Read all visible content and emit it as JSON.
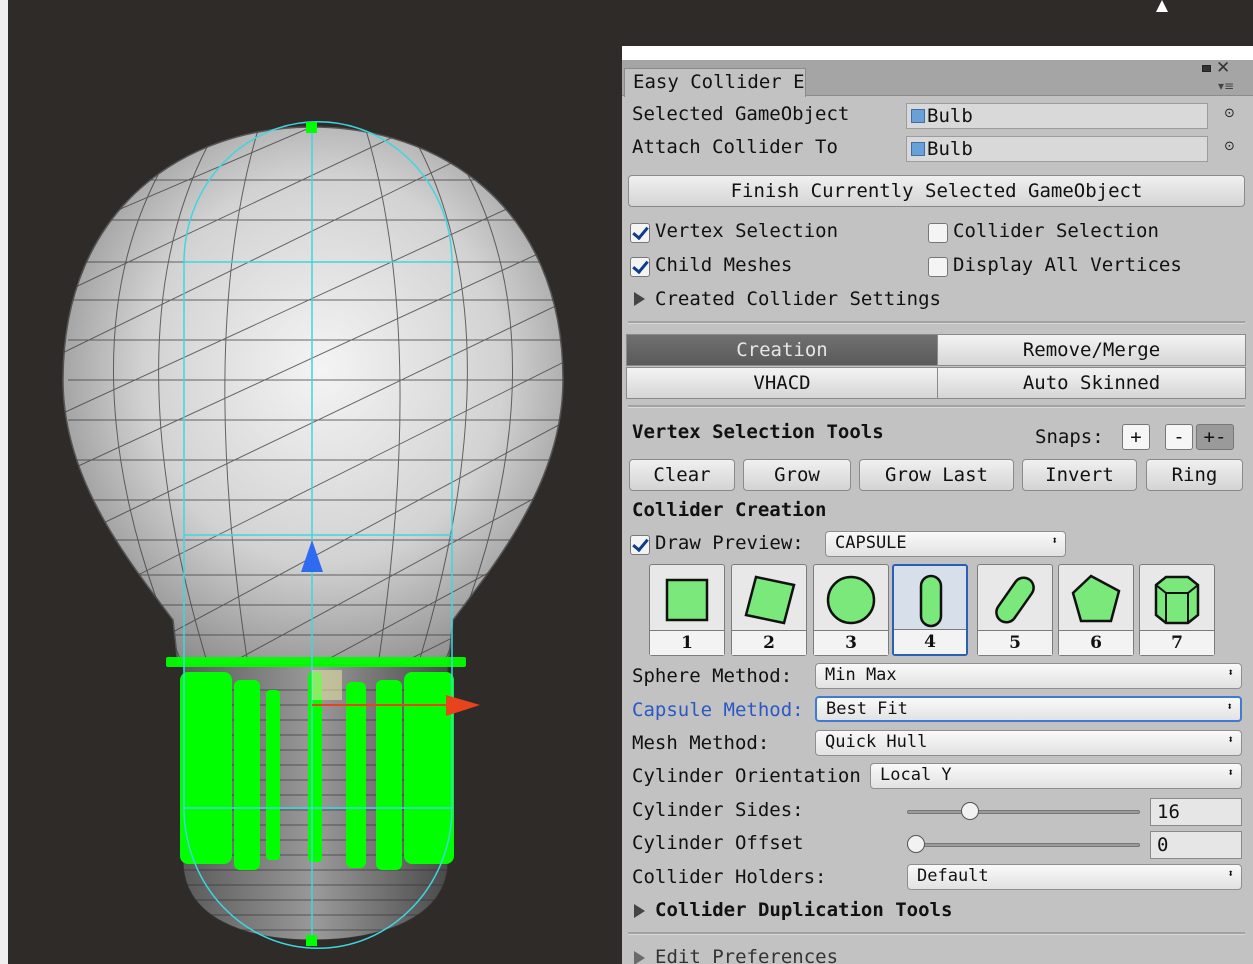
{
  "window": {
    "tab_title": "Easy Collider E"
  },
  "fields": {
    "selected_gameobject_label": "Selected GameObject",
    "selected_gameobject_value": "Bulb",
    "attach_collider_label": "Attach Collider To",
    "attach_collider_value": "Bulb"
  },
  "buttons": {
    "finish": "Finish Currently Selected GameObject"
  },
  "toggles": [
    {
      "label": "Vertex Selection",
      "checked": true
    },
    {
      "label": "Collider Selection",
      "checked": false
    },
    {
      "label": "Child Meshes",
      "checked": true
    },
    {
      "label": "Display All Vertices",
      "checked": false
    }
  ],
  "created_collider_settings": "Created Collider Settings",
  "mode_tabs": [
    {
      "label": "Creation",
      "active": true
    },
    {
      "label": "Remove/Merge",
      "active": false
    },
    {
      "label": "VHACD",
      "active": false
    },
    {
      "label": "Auto Skinned",
      "active": false
    }
  ],
  "vertex_tools": {
    "title": "Vertex Selection Tools",
    "snaps_label": "Snaps:",
    "snap_plus": "+",
    "snap_minus": "-",
    "snap_plusminus": "+-",
    "buttons": [
      "Clear",
      "Grow",
      "Grow Last",
      "Invert",
      "Ring"
    ]
  },
  "collider_creation": {
    "title": "Collider Creation",
    "draw_preview_label": "Draw Preview:",
    "draw_preview_checked": true,
    "preview_type": "CAPSULE",
    "shape_buttons": [
      {
        "num": "1",
        "icon": "box-collider-icon"
      },
      {
        "num": "2",
        "icon": "rotated-box-collider-icon"
      },
      {
        "num": "3",
        "icon": "sphere-collider-icon"
      },
      {
        "num": "4",
        "icon": "capsule-collider-icon",
        "selected": true
      },
      {
        "num": "5",
        "icon": "rotated-capsule-collider-icon"
      },
      {
        "num": "6",
        "icon": "convex-mesh-collider-icon"
      },
      {
        "num": "7",
        "icon": "cylinder-collider-icon"
      }
    ]
  },
  "methods": {
    "sphere_label": "Sphere Method:",
    "sphere_value": "Min Max",
    "capsule_label": "Capsule Method:",
    "capsule_value": "Best Fit",
    "mesh_label": "Mesh Method:",
    "mesh_value": "Quick Hull",
    "cyl_orient_label": "Cylinder Orientation",
    "cyl_orient_value": "Local Y",
    "cyl_sides_label": "Cylinder Sides:",
    "cyl_sides_value": "16",
    "cyl_offset_label": "Cylinder Offset",
    "cyl_offset_value": "0",
    "holders_label": "Collider Holders:",
    "holders_value": "Default"
  },
  "sliders": {
    "cylinder_sides_fraction": 0.23,
    "cylinder_offset_fraction": 0.0
  },
  "foldouts": {
    "duplication": "Collider Duplication Tools",
    "edit_prefs": "Edit Preferences"
  },
  "colors": {
    "selected_vertex": "#00ff00",
    "collider_preview": "#3fd6e0",
    "x_axis": "#e8431c",
    "y_axis": "#2f6bf0",
    "active_tab": "#666666",
    "focused_label": "#2a58c4"
  }
}
